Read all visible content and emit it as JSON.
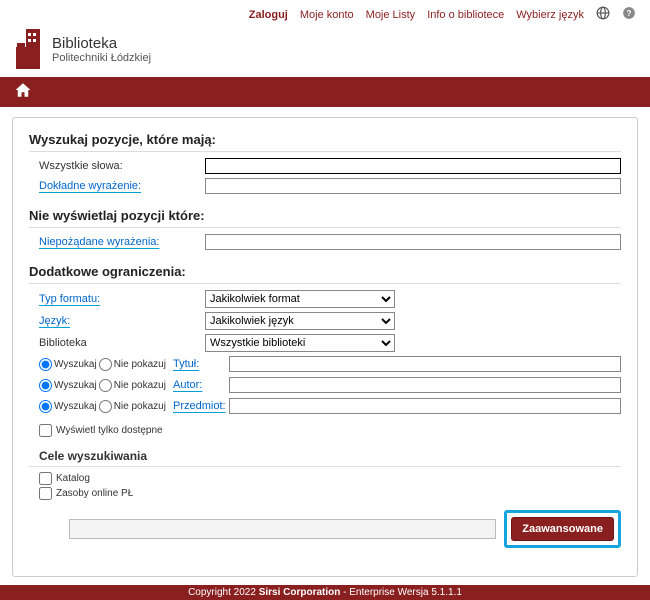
{
  "topnav": {
    "login": "Zaloguj",
    "account": "Moje konto",
    "lists": "Moje Listy",
    "info": "Info o bibliotece",
    "lang": "Wybierz język"
  },
  "brand": {
    "line1": "Biblioteka",
    "line2": "Politechniki Łódzkiej"
  },
  "sections": {
    "have_head": "Wyszukaj pozycje, które mają:",
    "all_words": "Wszystkie słowa:",
    "exact_phrase": "Dokładne wyrażenie:",
    "nothave_head": "Nie wyświetlaj pozycji które:",
    "unwanted": "Niepożądane wyrażenia:",
    "limits_head": "Dodatkowe ograniczenia:",
    "format": "Typ formatu:",
    "lang": "Język:",
    "library": "Biblioteka",
    "format_opt": "Jakikolwiek format",
    "lang_opt": "Jakikolwiek język",
    "library_opt": "Wszystkie biblioteki",
    "radio_show": "Wyszukaj",
    "radio_hide": "Nie pokazuj",
    "title": "Tytuł:",
    "author": "Autor:",
    "subject": "Przedmiot:",
    "available_only": "Wyświetl tylko dostępne",
    "targets_head": "Cele wyszukiwania",
    "target1": "Katalog",
    "target2": "Zasoby online PŁ",
    "adv_btn": "Zaawansowane"
  },
  "footer": {
    "copyright": "Copyright 2022 ",
    "corp": "Sirsi Corporation",
    "rest": " - Enterprise Wersja 5.1.1.1"
  }
}
